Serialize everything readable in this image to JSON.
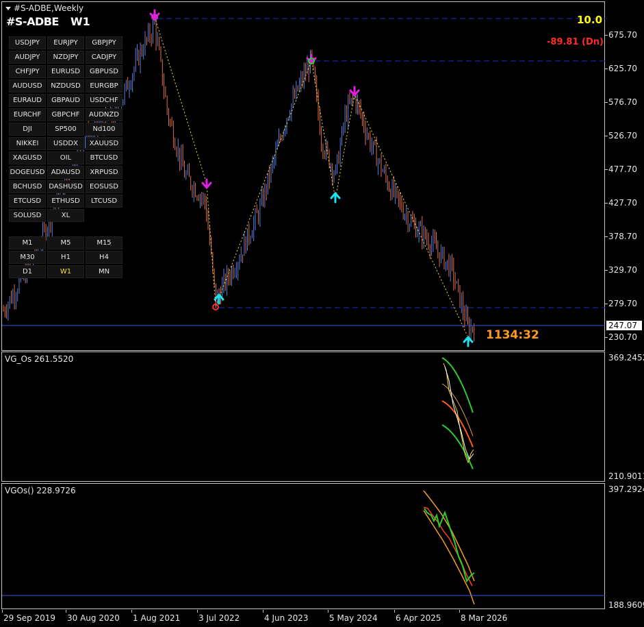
{
  "window": {
    "title": "#S-ADBE,Weekly",
    "symbol": "#S-ADBE",
    "timeframe": "W1"
  },
  "main": {
    "price_scale": [
      "675.70",
      "625.70",
      "576.70",
      "526.70",
      "477.70",
      "427.70",
      "378.70",
      "329.70",
      "279.70",
      "230.70"
    ],
    "current_price": "247.07",
    "top_value": "10.0",
    "direction_value": "-89.81 (Dn)",
    "timer": "1134:32"
  },
  "symbol_buttons": [
    [
      "USDJPY",
      "EURJPY",
      "GBPJPY"
    ],
    [
      "AUDJPY",
      "NZDJPY",
      "CADJPY"
    ],
    [
      "CHFJPY",
      "EURUSD",
      "GBPUSD"
    ],
    [
      "AUDUSD",
      "NZDUSD",
      "EURGBP"
    ],
    [
      "EURAUD",
      "GBPAUD",
      "USDCHF"
    ],
    [
      "EURCHF",
      "GBPCHF",
      "AUDNZD"
    ],
    [
      "DJI",
      "SP500",
      "Nd100"
    ],
    [
      "NIKKEI",
      "USDDX",
      "XAUUSD"
    ],
    [
      "XAGUSD",
      "OIL",
      "BTCUSD"
    ],
    [
      "DOGEUSD",
      "ADAUSD",
      "XRPUSD"
    ],
    [
      "BCHUSD",
      "DASHUSD",
      "EOSUSD"
    ],
    [
      "ETCUSD",
      "ETHUSD",
      "LTCUSD"
    ],
    [
      "SOLUSD",
      "XL"
    ]
  ],
  "timeframe_buttons": [
    [
      "M1",
      "M5",
      "M15"
    ],
    [
      "M30",
      "H1",
      "H4"
    ],
    [
      "D1",
      "W1",
      "MN"
    ]
  ],
  "active_timeframe": "W1",
  "indicator1": {
    "title": "VG_Os 261.5520",
    "scale_max": "369.2452",
    "scale_min": "210.9011"
  },
  "indicator2": {
    "title": "VGOs() 228.9726",
    "scale_max": "397.2924",
    "scale_min": "188.9609"
  },
  "x_axis": [
    "29 Sep 2019",
    "30 Aug 2020",
    "1 Aug 2021",
    "3 Jul 2022",
    "4 Jun 2023",
    "5 May 2024",
    "6 Apr 2025",
    "8 Mar 2026"
  ],
  "colors": {
    "bull": "#5b7fe0",
    "bear": "#e0704a",
    "down_arrow": "#e020e0",
    "up_arrow": "#20e0f0",
    "zigzag": "#f5e33a",
    "level_line": "#1e2ec8"
  }
}
